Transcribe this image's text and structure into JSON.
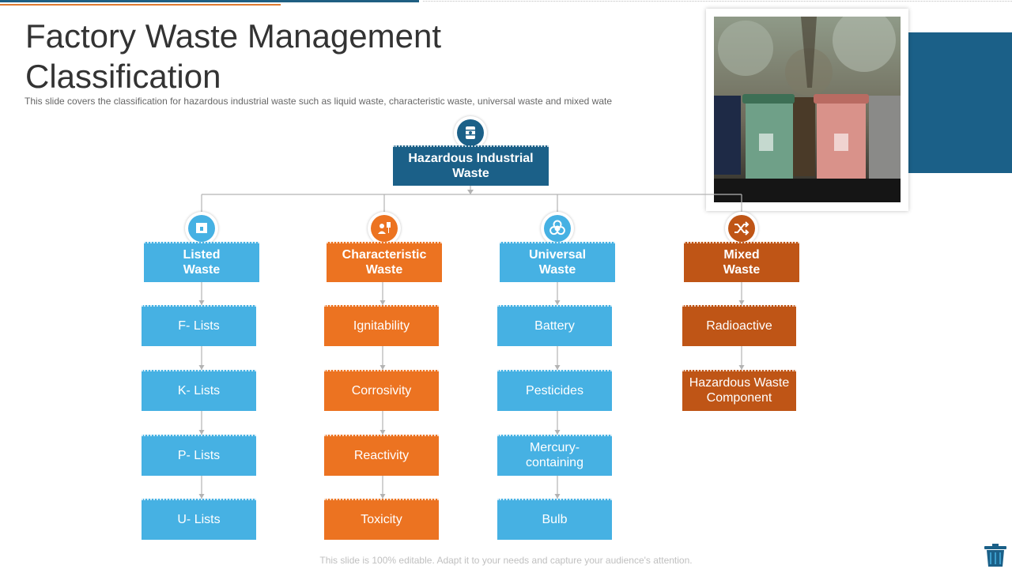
{
  "title": "Factory Waste Management Classification",
  "subtitle": "This slide covers the classification for hazardous industrial waste such as liquid waste, characteristic waste, universal  waste and mixed wate",
  "root": {
    "label": "Hazardous Industrial Waste",
    "icon": "barrel-icon"
  },
  "categories": [
    {
      "label": "Listed Waste",
      "icon": "container-icon",
      "color": "#46b1e3",
      "items": [
        "F- Lists",
        "K- Lists",
        "P- Lists",
        "U- Lists"
      ]
    },
    {
      "label": "Characteristic Waste",
      "icon": "worker-icon",
      "color": "#ec7321",
      "items": [
        "Ignitability",
        "Corrosivity",
        "Reactivity",
        "Toxicity"
      ]
    },
    {
      "label": "Universal Waste",
      "icon": "biohazard-icon",
      "color": "#46b1e3",
      "items": [
        "Battery",
        "Pesticides",
        "Mercury- containing",
        "Bulb"
      ]
    },
    {
      "label": "Mixed Waste",
      "icon": "shuffle-icon",
      "color": "#bf5516",
      "items": [
        "Radioactive",
        "Hazardous Waste Component"
      ]
    }
  ],
  "footer": "This slide is 100% editable. Adapt it to your needs and capture your audience's attention.",
  "colors": {
    "navy": "#1b6088",
    "blue": "#46b1e3",
    "orange": "#ec7321",
    "rust": "#bf5516",
    "accent_orange": "#e07a2f"
  }
}
